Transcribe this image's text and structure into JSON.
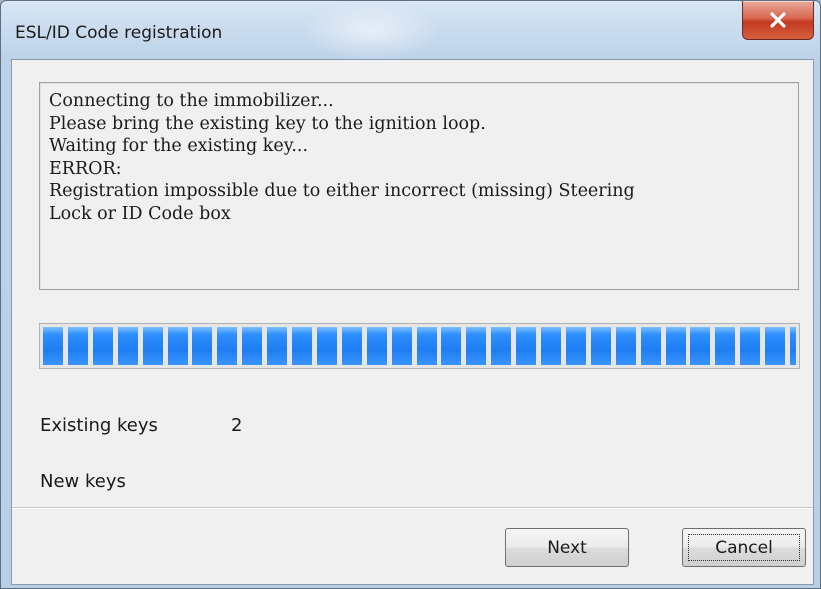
{
  "window": {
    "title": "ESL/ID Code registration",
    "close_icon": "close-icon"
  },
  "log": {
    "lines": [
      "Connecting to the immobilizer...",
      "Please bring the existing key to the ignition loop.",
      "Waiting for the existing key...",
      "ERROR:",
      "Registration impossible due to either incorrect (missing) Steering",
      "Lock or ID Code box"
    ]
  },
  "progress": {
    "fraction": 1.0,
    "color": "#2f8fff"
  },
  "fields": {
    "existing_keys_label": "Existing keys",
    "existing_keys_value": "2",
    "new_keys_label": "New keys",
    "new_keys_value": ""
  },
  "buttons": {
    "next_label": "Next",
    "cancel_label": "Cancel"
  }
}
